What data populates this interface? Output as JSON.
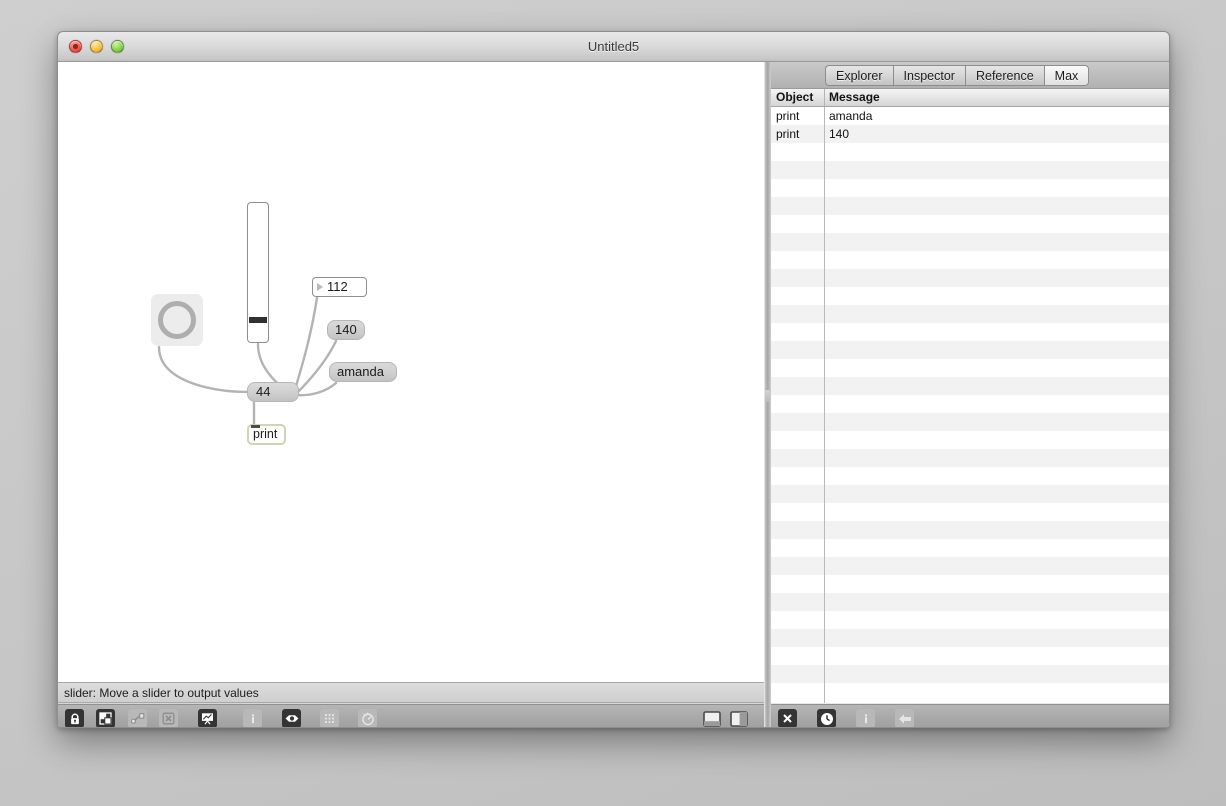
{
  "window": {
    "title": "Untitled5",
    "traffic_lights": [
      "close-button",
      "minimize-button",
      "zoom-button"
    ]
  },
  "patcher": {
    "status_text": "slider: Move a slider to output values",
    "objects": [
      {
        "id": "dial",
        "kind": "dial",
        "label": ""
      },
      {
        "id": "slider",
        "kind": "slider",
        "label": ""
      },
      {
        "id": "number",
        "kind": "number-box",
        "label": "112"
      },
      {
        "id": "msg140",
        "kind": "message-box",
        "label": "140"
      },
      {
        "id": "msgamanda",
        "kind": "message-box",
        "label": "amanda"
      },
      {
        "id": "msg44",
        "kind": "message-box",
        "label": "44"
      },
      {
        "id": "print",
        "kind": "object-box",
        "label": "print"
      }
    ],
    "toolbar": {
      "buttons": [
        {
          "name": "lock-unlock-icon",
          "state": "dark",
          "title": "lock"
        },
        {
          "name": "presentation-mode-icon",
          "state": "dark",
          "title": "presentation"
        },
        {
          "name": "patch-cord-icon",
          "state": "light",
          "title": "patch cords"
        },
        {
          "name": "delete-cord-icon",
          "state": "light",
          "title": "remove cords"
        },
        {
          "name": "palette-icon",
          "state": "dark",
          "title": "object palette"
        },
        {
          "name": "inspector-info-icon",
          "state": "light",
          "title": "inspector"
        },
        {
          "name": "snap-object-icon",
          "state": "dark",
          "title": "snap"
        },
        {
          "name": "grid-icon",
          "state": "light",
          "title": "grid"
        },
        {
          "name": "debug-icon",
          "state": "light",
          "title": "debug"
        }
      ],
      "panel_toggles": [
        {
          "name": "bottom-panel-toggle-icon"
        },
        {
          "name": "side-panel-toggle-icon"
        }
      ]
    }
  },
  "console": {
    "tabs": [
      {
        "label": "Explorer",
        "active": false
      },
      {
        "label": "Inspector",
        "active": false
      },
      {
        "label": "Reference",
        "active": false
      },
      {
        "label": "Max",
        "active": true
      }
    ],
    "columns": {
      "object": "Object",
      "message": "Message"
    },
    "rows": [
      {
        "object": "print",
        "message": "amanda"
      },
      {
        "object": "print",
        "message": "140"
      }
    ],
    "empty_row_count": 31,
    "toolbar": {
      "buttons": [
        {
          "name": "clear-console-icon",
          "state": "dark",
          "title": "clear"
        },
        {
          "name": "clock-icon",
          "state": "dark",
          "title": "timestamps"
        },
        {
          "name": "info-icon",
          "state": "light",
          "title": "info"
        },
        {
          "name": "back-arrow-icon",
          "state": "light",
          "title": "back"
        }
      ]
    }
  },
  "colors": {
    "canvas": "#ffffff",
    "chrome": "#b0b0b0",
    "msgbox": "#cfcfcf",
    "objbox_border": "#cdd6b0",
    "patch_cord": "#b3b3b3",
    "row_alt": "#f2f2f2"
  }
}
